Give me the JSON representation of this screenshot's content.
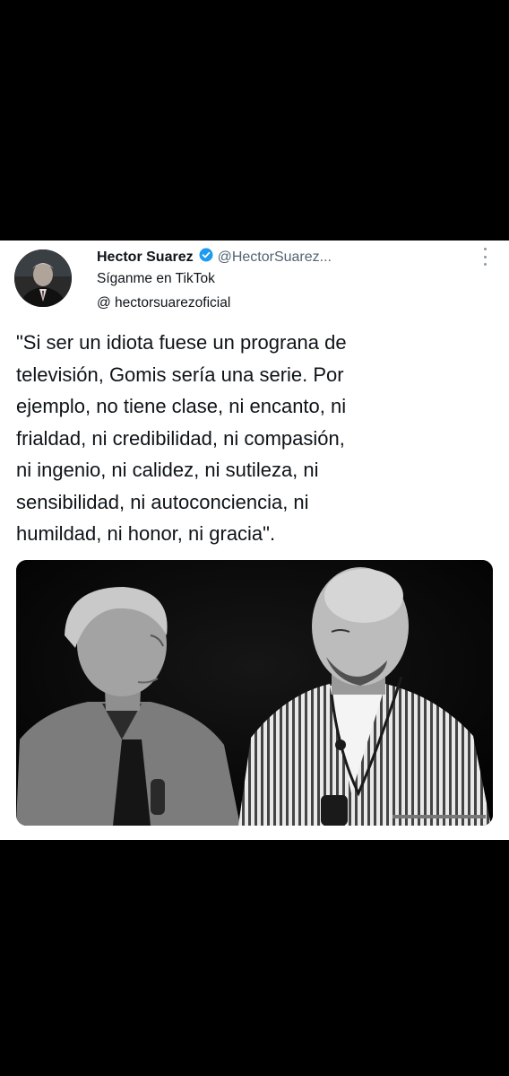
{
  "tweet": {
    "author": {
      "name": "Hector Suarez",
      "handle": "@HectorSuarez...",
      "bio_line1": "Síganme en TikTok",
      "bio_line2": "@ hectorsuarezoficial"
    },
    "text_lines": [
      "\"Si ser un idiota fuese un prograna de",
      "televisión, Gomis sería una serie. Por",
      "ejemplo, no tiene clase, ni encanto, ni",
      "frialdad, ni credibilidad, ni compasión,",
      "ni ingenio, ni calidez, ni sutileza, ni",
      "sensibilidad, ni autoconciencia, ni",
      "humildad, ni honor, ni gracia\"."
    ]
  },
  "icons": {
    "verified": "verified-badge-icon",
    "more": "more-options-icon"
  },
  "colors": {
    "background": "#000000",
    "card": "#ffffff",
    "text": "#0f1419",
    "secondary_text": "#536471",
    "verified": "#1d9bf0"
  }
}
